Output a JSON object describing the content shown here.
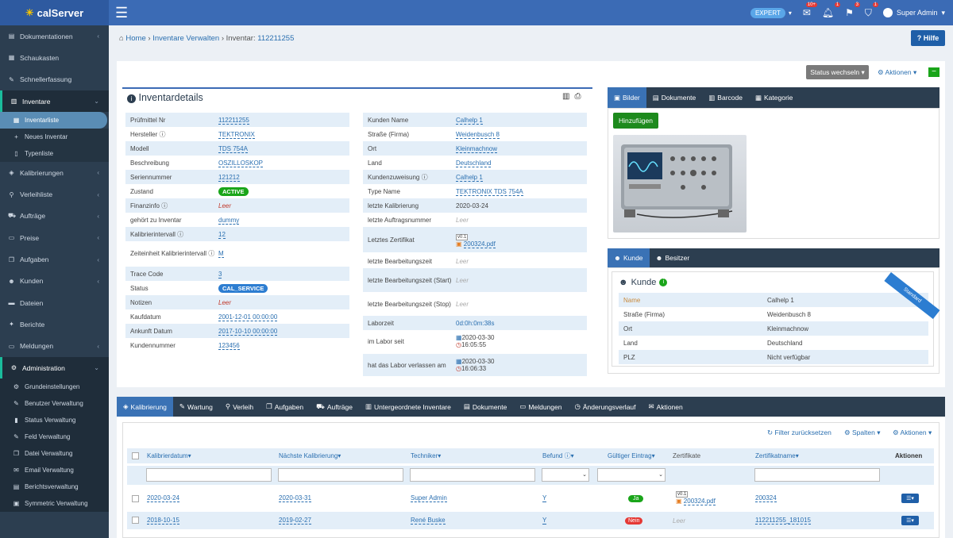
{
  "topbar": {
    "logo": "calServer",
    "expert_label": "EXPERT",
    "badges": {
      "mail": "10+",
      "bell": "1",
      "flag": "3",
      "gift": "1"
    },
    "user": "Super Admin"
  },
  "sidebar": {
    "items": [
      {
        "label": "Dokumentationen"
      },
      {
        "label": "Schaukasten"
      },
      {
        "label": "Schnellerfassung"
      },
      {
        "label": "Inventare"
      },
      {
        "label": "Kalibrierungen"
      },
      {
        "label": "Verleihliste"
      },
      {
        "label": "Aufträge"
      },
      {
        "label": "Preise"
      },
      {
        "label": "Aufgaben"
      },
      {
        "label": "Kunden"
      },
      {
        "label": "Dateien"
      },
      {
        "label": "Berichte"
      },
      {
        "label": "Meldungen"
      },
      {
        "label": "Administration"
      }
    ],
    "inventare_sub": [
      {
        "label": "Inventarliste"
      },
      {
        "label": "Neues Inventar"
      },
      {
        "label": "Typenliste"
      }
    ],
    "admin_sub": [
      {
        "label": "Grundeinstellungen"
      },
      {
        "label": "Benutzer Verwaltung"
      },
      {
        "label": "Status Verwaltung"
      },
      {
        "label": "Feld Verwaltung"
      },
      {
        "label": "Datei Verwaltung"
      },
      {
        "label": "Email Verwaltung"
      },
      {
        "label": "Berichtsverwaltung"
      },
      {
        "label": "Symmetric Verwaltung"
      }
    ]
  },
  "breadcrumb": {
    "home": "Home",
    "level1": "Inventare Verwalten",
    "level2_label": "Inventar:",
    "level2_value": "112211255"
  },
  "help_label": "Hilfe",
  "status_button": "Status wechseln",
  "actions_label": "Aktionen",
  "inventory": {
    "title": "Inventardetails",
    "left": [
      {
        "k": "Prüfmittel Nr",
        "v": "112211255"
      },
      {
        "k": "Hersteller",
        "v": "TEKTRONIX"
      },
      {
        "k": "Modell",
        "v": "TDS 754A"
      },
      {
        "k": "Beschreibung",
        "v": "OSZILLOSKOP"
      },
      {
        "k": "Seriennummer",
        "v": "121212"
      },
      {
        "k": "Zustand",
        "v": "ACTIVE"
      },
      {
        "k": "Finanzinfo",
        "v": "Leer"
      },
      {
        "k": "gehört zu Inventar",
        "v": "dummy"
      },
      {
        "k": "Kalibrierintervall",
        "v": "12"
      },
      {
        "k": "Zeiteinheit Kalibrierintervall",
        "v": "M"
      },
      {
        "k": "Trace Code",
        "v": "3"
      },
      {
        "k": "Status",
        "v": "CAL_SERVICE"
      },
      {
        "k": "Notizen",
        "v": "Leer"
      },
      {
        "k": "Kaufdatum",
        "v": "2001-12-01 00:00:00"
      },
      {
        "k": "Ankunft Datum",
        "v": "2017-10-10 00:00:00"
      },
      {
        "k": "Kundennummer",
        "v": "123456"
      }
    ],
    "right": [
      {
        "k": "Kunden Name",
        "v": "Calhelp 1"
      },
      {
        "k": "Straße (Firma)",
        "v": "Weidenbusch 8"
      },
      {
        "k": "Ort",
        "v": "Kleinmachnow"
      },
      {
        "k": "Land",
        "v": "Deutschland"
      },
      {
        "k": "Kundenzuweisung",
        "v": "Calhelp 1"
      },
      {
        "k": "Type Name",
        "v": "TEKTRONIX TDS 754A"
      },
      {
        "k": "letzte Kalibrierung",
        "v": "2020-03-24"
      },
      {
        "k": "letzte Auftragsnummer",
        "v": "Leer"
      },
      {
        "k": "Letztes Zertifikat",
        "v": "200324.pdf",
        "version": "v0.1"
      },
      {
        "k": "letzte Bearbeitungszeit",
        "v": "Leer"
      },
      {
        "k": "letzte Bearbeitungszeit (Start)",
        "v": "Leer"
      },
      {
        "k": "letzte Bearbeitungszeit (Stop)",
        "v": "Leer"
      },
      {
        "k": "Laborzeit",
        "v": "0d:0h:0m:38s"
      },
      {
        "k": "im Labor seit",
        "v": "2020-03-30",
        "v2": "16:05:55"
      },
      {
        "k": "hat das Labor verlassen am",
        "v": "2020-03-30",
        "v2": "16:06:33"
      }
    ]
  },
  "media_tabs": [
    {
      "label": "Bilder"
    },
    {
      "label": "Dokumente"
    },
    {
      "label": "Barcode"
    },
    {
      "label": "Kategorie"
    }
  ],
  "add_button": "Hinzufügen",
  "customer_tabs": [
    {
      "label": "Kunde"
    },
    {
      "label": "Besitzer"
    }
  ],
  "customer": {
    "title": "Kunde",
    "ribbon": "Standard",
    "rows": [
      {
        "k": "Name",
        "v": "Calhelp 1"
      },
      {
        "k": "Straße (Firma)",
        "v": "Weidenbusch 8"
      },
      {
        "k": "Ort",
        "v": "Kleinmachnow"
      },
      {
        "k": "Land",
        "v": "Deutschland"
      },
      {
        "k": "PLZ",
        "v": "Nicht verfügbar"
      }
    ]
  },
  "bottom_tabs": [
    {
      "label": "Kalibrierung"
    },
    {
      "label": "Wartung"
    },
    {
      "label": "Verleih"
    },
    {
      "label": "Aufgaben"
    },
    {
      "label": "Aufträge"
    },
    {
      "label": "Untergeordnete Inventare"
    },
    {
      "label": "Dokumente"
    },
    {
      "label": "Meldungen"
    },
    {
      "label": "Änderungsverlauf"
    },
    {
      "label": "Aktionen"
    }
  ],
  "table_tools": {
    "reset": "Filter zurücksetzen",
    "columns": "Spalten",
    "actions": "Aktionen"
  },
  "table": {
    "headers": [
      "Kalibrierdatum",
      "Nächste Kalibrierung",
      "Techniker",
      "Befund",
      "Gültiger Eintrag",
      "Zertifikate",
      "Zertifikatname",
      "Aktionen"
    ],
    "rows": [
      {
        "date": "2020-03-24",
        "next": "2020-03-31",
        "tech": "Super Admin",
        "befund": "Y",
        "valid": "Ja",
        "cert": "200324.pdf",
        "cert_version": "v0.1",
        "certname": "200324"
      },
      {
        "date": "2018-10-15",
        "next": "2019-02-27",
        "tech": "René Buske",
        "befund": "Y",
        "valid": "Nein",
        "cert": "Leer",
        "certname": "112211255_181015"
      }
    ]
  }
}
